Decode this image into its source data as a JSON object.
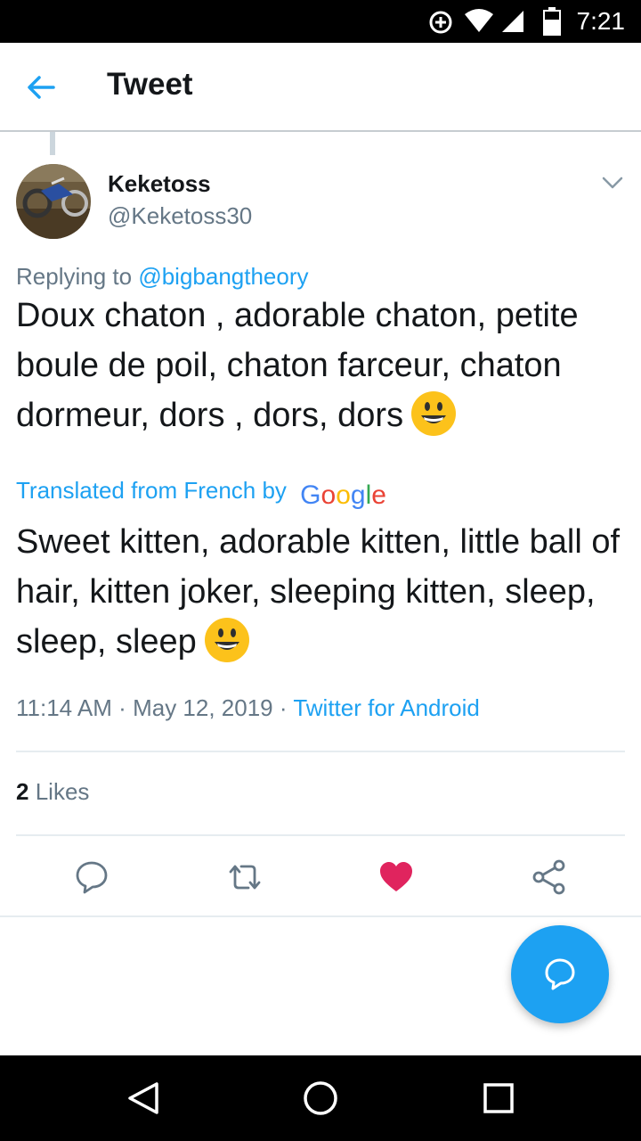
{
  "status_bar": {
    "time": "7:21"
  },
  "app_bar": {
    "title": "Tweet"
  },
  "tweet": {
    "author_name": "Keketoss",
    "author_handle": "@Keketoss30",
    "replying_prefix": "Replying to",
    "replying_to": "@bigbangtheory",
    "text": "Doux chaton , adorable chaton, petite boule de poil, chaton farceur, chaton dormeur, dors , dors, dors",
    "translated_label": "Translated from French by",
    "translator_brand": "Google",
    "translated_text": "Sweet kitten, adorable kitten, little ball of hair, kitten joker, sleeping kitten, sleep, sleep, sleep",
    "time": "11:14 AM",
    "date": "May 12, 2019",
    "source": "Twitter for Android",
    "separator": "·",
    "likes_count": "2",
    "likes_label": "Likes"
  },
  "icons": {
    "back": "arrow-left-icon",
    "caret": "chevron-down-icon",
    "reply": "reply-icon",
    "retweet": "retweet-icon",
    "like": "heart-icon",
    "share": "share-icon",
    "fab": "compose-reply-icon"
  },
  "colors": {
    "accent": "#1da1f2",
    "like": "#e0245e",
    "muted": "#657786",
    "text": "#14171a"
  }
}
